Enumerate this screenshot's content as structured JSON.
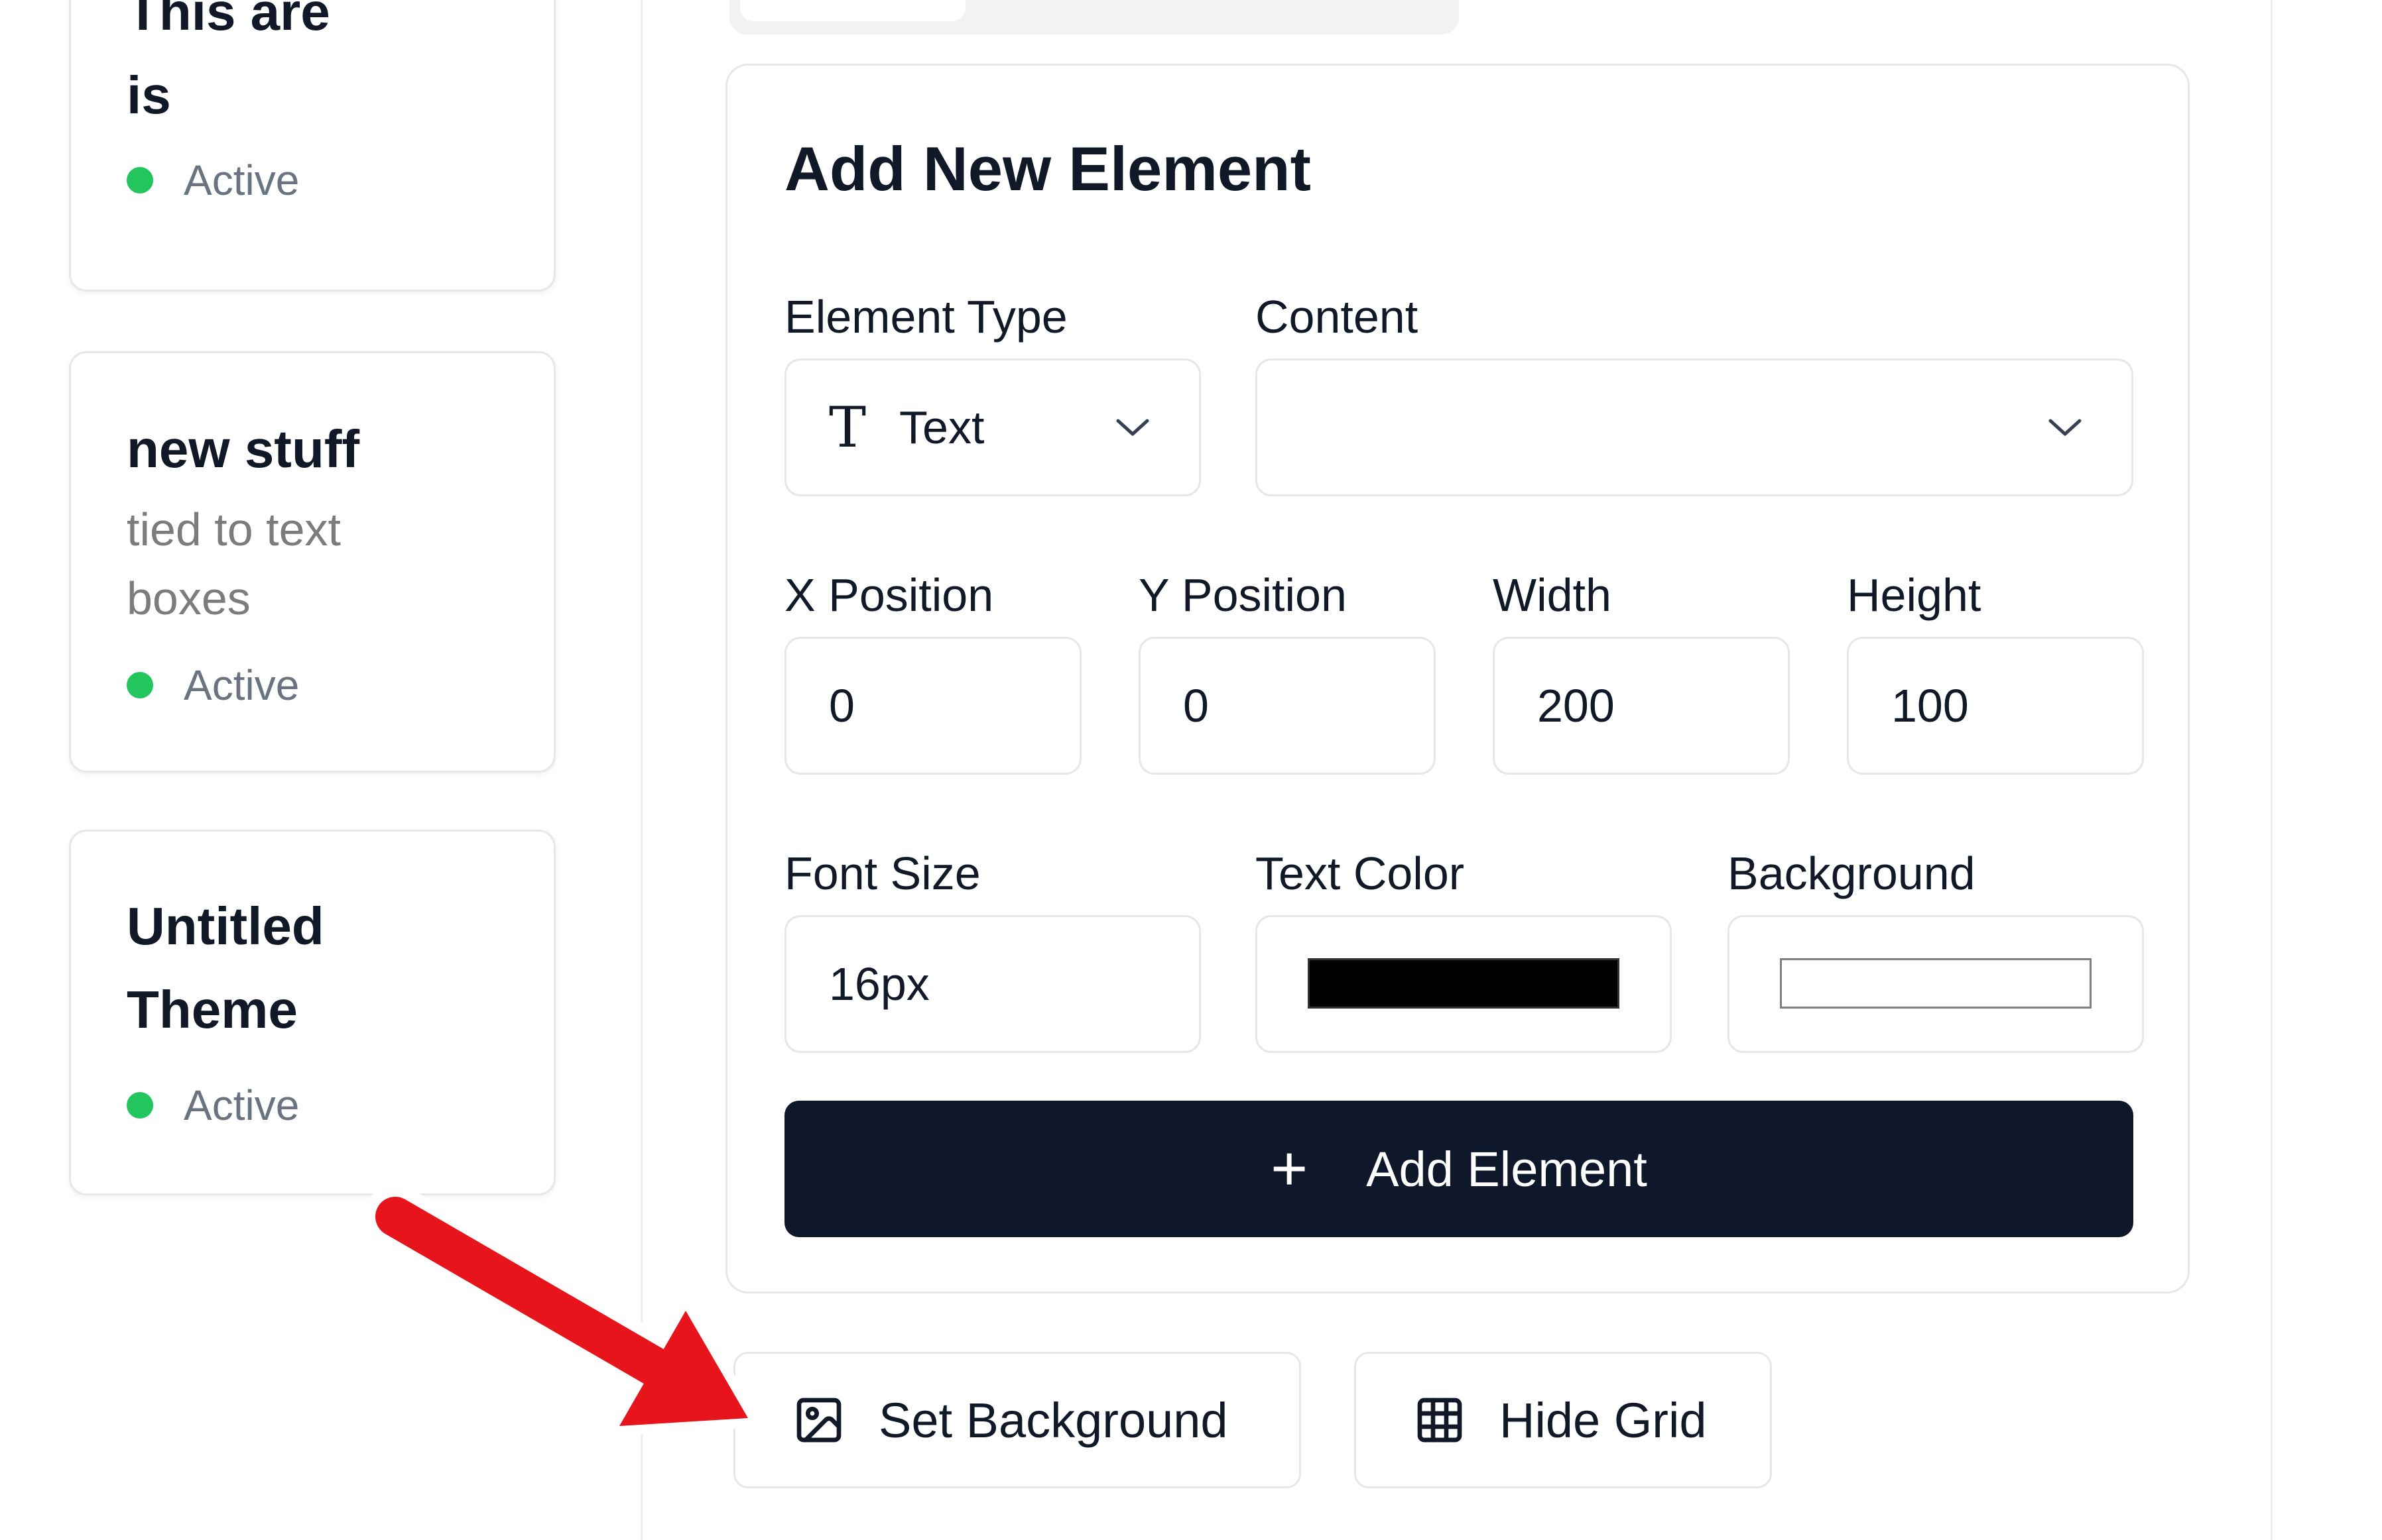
{
  "themes": [
    {
      "title_line1": "This are",
      "title_line2": "is",
      "status": "Active"
    },
    {
      "title_line1": "new stuff",
      "description_line1": "tied to text",
      "description_line2": "boxes",
      "status": "Active"
    },
    {
      "title_line1": "Untitled",
      "title_line2": "Theme",
      "status": "Active"
    }
  ],
  "form": {
    "title": "Add New Element",
    "element_type_label": "Element Type",
    "element_type_value": "Text",
    "content_label": "Content",
    "content_value": "",
    "x_label": "X Position",
    "x_value": "0",
    "y_label": "Y Position",
    "y_value": "0",
    "width_label": "Width",
    "width_value": "200",
    "height_label": "Height",
    "height_value": "100",
    "font_size_label": "Font Size",
    "font_size_value": "16px",
    "text_color_label": "Text Color",
    "text_color_value": "#000000",
    "background_label": "Background",
    "background_value": "#ffffff",
    "add_button_label": "Add Element"
  },
  "toolbar": {
    "set_background_label": "Set Background",
    "hide_grid_label": "Hide Grid"
  },
  "colors": {
    "status_active": "#22c55e",
    "primary_button": "#0f172a",
    "annotation_arrow": "#e8141b"
  },
  "icons": {
    "element_type": "text-type-icon",
    "add": "plus-icon",
    "background": "image-icon",
    "grid": "grid-icon"
  }
}
